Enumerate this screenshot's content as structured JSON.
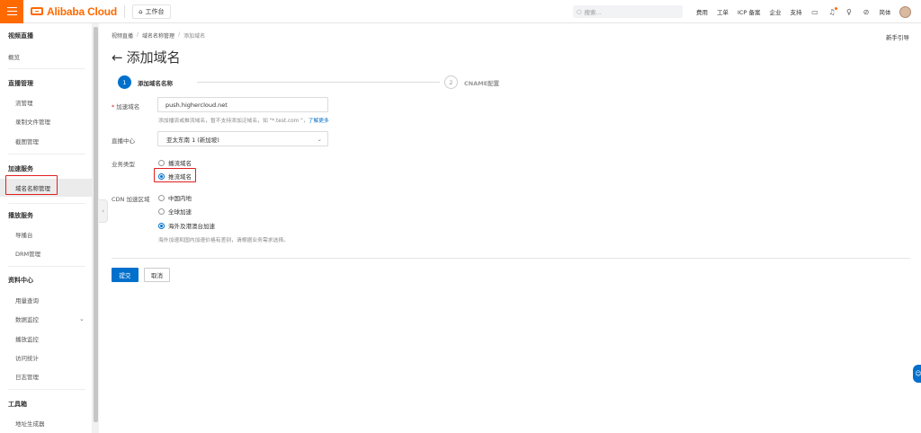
{
  "topbar": {
    "brand": "Alibaba Cloud",
    "workbench": "工作台",
    "search_placeholder": "搜索...",
    "nav": [
      "费用",
      "工单",
      "ICP 备案",
      "企业",
      "支持"
    ],
    "language": "简体"
  },
  "sidebar": {
    "title": "视频直播",
    "overview": "概览",
    "groups": [
      {
        "label": "直播管理",
        "items": [
          "流管理",
          "录制文件管理",
          "截图管理"
        ]
      },
      {
        "label": "加速服务",
        "items": [
          "域名名称管理"
        ]
      },
      {
        "label": "播放服务",
        "items": [
          "导播台",
          "DRM管理"
        ]
      },
      {
        "label": "资料中心",
        "items": [
          "用量查询",
          "数据监控",
          "播放监控",
          "访问统计",
          "日志管理"
        ]
      },
      {
        "label": "工具箱",
        "items": [
          "地址生成器"
        ]
      }
    ]
  },
  "breadcrumb": [
    "视频直播",
    "域名名称管理",
    "添加域名"
  ],
  "guide_link": "新手引导",
  "page_title": "添加域名",
  "steps": [
    {
      "num": "1",
      "label": "添加域名名称"
    },
    {
      "num": "2",
      "label": "CNAME配置"
    }
  ],
  "form": {
    "domain_label": "加速域名",
    "domain_value": "push.highercloud.net",
    "domain_hint": "添加播流或推流域名，暂不支持添加泛域名，如 \"*.test.com \"，",
    "domain_hint_link": "了解更多",
    "region_label": "直播中心",
    "region_value": "亚太东南 1 (新加坡)",
    "type_label": "业务类型",
    "type_options": [
      "播流域名",
      "推流域名"
    ],
    "type_selected": 1,
    "cdn_label": "CDN 加速区域",
    "cdn_options": [
      "中国内地",
      "全球加速",
      "海外及港澳台加速"
    ],
    "cdn_selected": 2,
    "cdn_hint": "海外加速和国内加速价格有差别，请根据业务需求选择。"
  },
  "buttons": {
    "submit": "提交",
    "cancel": "取消"
  },
  "colors": {
    "brand": "#ff6a00",
    "primary": "#0070cc",
    "highlight": "#e02020"
  }
}
